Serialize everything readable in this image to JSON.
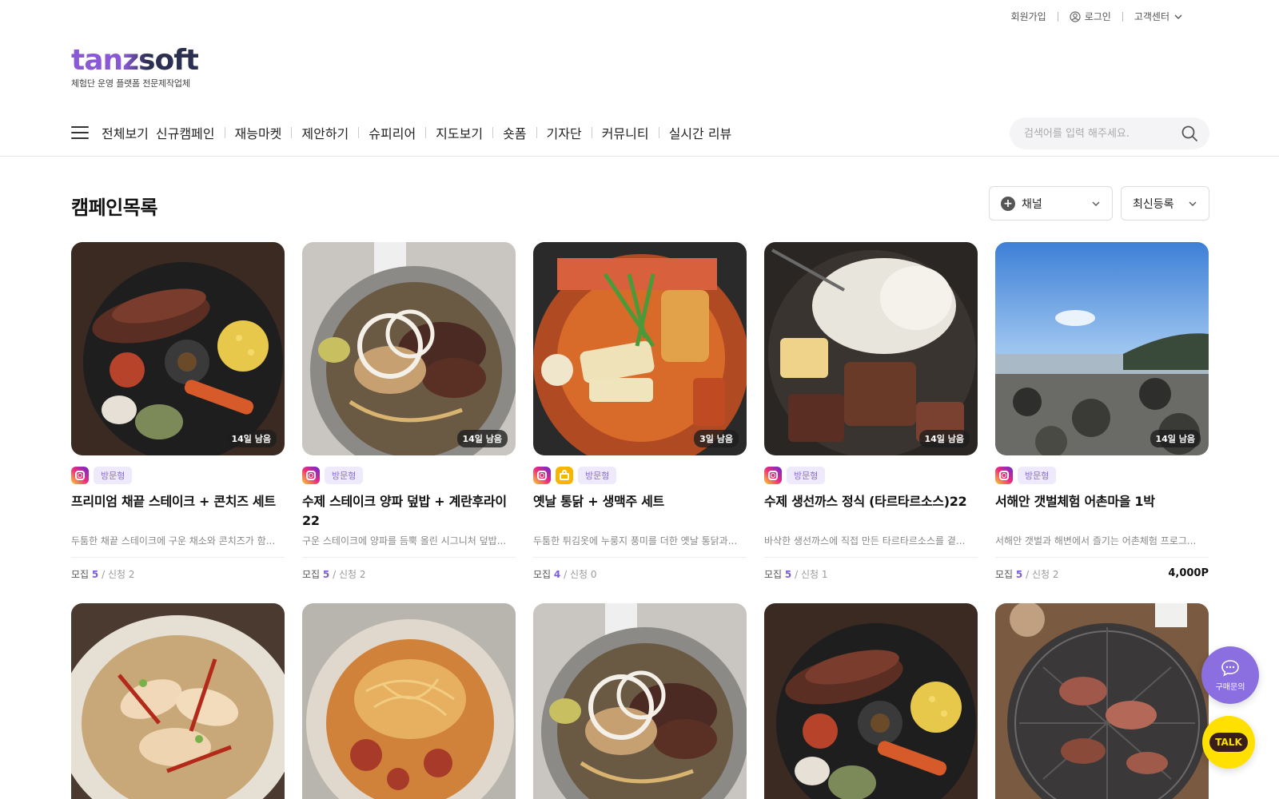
{
  "topbar": {
    "signup": "회원가입",
    "login": "로그인",
    "support": "고객센터"
  },
  "logo": {
    "wordmark": "tanzsoft",
    "tagline": "체험단 운영 플랫폼 전문제작업체"
  },
  "nav": {
    "items": [
      "전체보기",
      "신규캠페인",
      "재능마켓",
      "제안하기",
      "슈피리어",
      "지도보기",
      "숏폼",
      "기자단",
      "커뮤니티",
      "실시간 리뷰"
    ]
  },
  "search": {
    "placeholder": "검색어를 입력 해주세요."
  },
  "section": {
    "title": "캠페인목록"
  },
  "filters": {
    "channel": "채널",
    "sort": "최신등록"
  },
  "colors": {
    "accent": "#7b5ce0",
    "badge_bg": "#eee9fb",
    "kakao": "#ffe000"
  },
  "campaigns": [
    {
      "days": "14일 남음",
      "type": "방문형",
      "title": "프리미엄 채끝 스테이크 + 콘치즈 세트",
      "desc": "두툼한 채끝 스테이크에 구운 채소와 콘치즈가 함...",
      "recruit_label": "모집",
      "recruit": "5",
      "apply": "/ 신청 2",
      "points": "",
      "thumb": "steak"
    },
    {
      "days": "14일 남음",
      "type": "방문형",
      "title": "수제 스테이크 양파 덮밥 + 계란후라이 22",
      "desc": "구운 스테이크에 양파를 듬뿍 올린 시그니처 덮밥...",
      "recruit_label": "모집",
      "recruit": "5",
      "apply": "/ 신청 2",
      "points": "",
      "thumb": "steakbowl"
    },
    {
      "days": "3일 남음",
      "type": "방문형",
      "title": "옛날 통닭 + 생맥주 세트",
      "desc": "두툼한 튀김옷에 누룽지 풍미를 더한 옛날 통닭과...",
      "recruit_label": "모집",
      "recruit": "4",
      "apply": "/ 신청 0",
      "points": "",
      "thumb": "chicken",
      "shop": true
    },
    {
      "days": "14일 남음",
      "type": "방문형",
      "title": "수제 생선까스 정식 (타르타르소스)22",
      "desc": "바삭한 생선까스에 직접 만든 타르타르소스를 곁...",
      "recruit_label": "모집",
      "recruit": "5",
      "apply": "/ 신청 1",
      "points": "",
      "thumb": "grill"
    },
    {
      "days": "14일 남음",
      "type": "방문형",
      "title": "서해안 갯벌체험 어촌마을 1박",
      "desc": "서해안 갯벌과 해변에서 즐기는 어촌체험 프로그...",
      "recruit_label": "모집",
      "recruit": "5",
      "apply": "/ 신청 2",
      "points": "4,000P",
      "thumb": "beach"
    }
  ],
  "campaigns_row2": [
    {
      "thumb": "shrimp"
    },
    {
      "thumb": "pasta"
    },
    {
      "thumb": "steakbowl"
    },
    {
      "thumb": "steak"
    },
    {
      "thumb": "bbq"
    }
  ],
  "fab": {
    "inquiry": "구매문의",
    "talk": "TALK"
  }
}
